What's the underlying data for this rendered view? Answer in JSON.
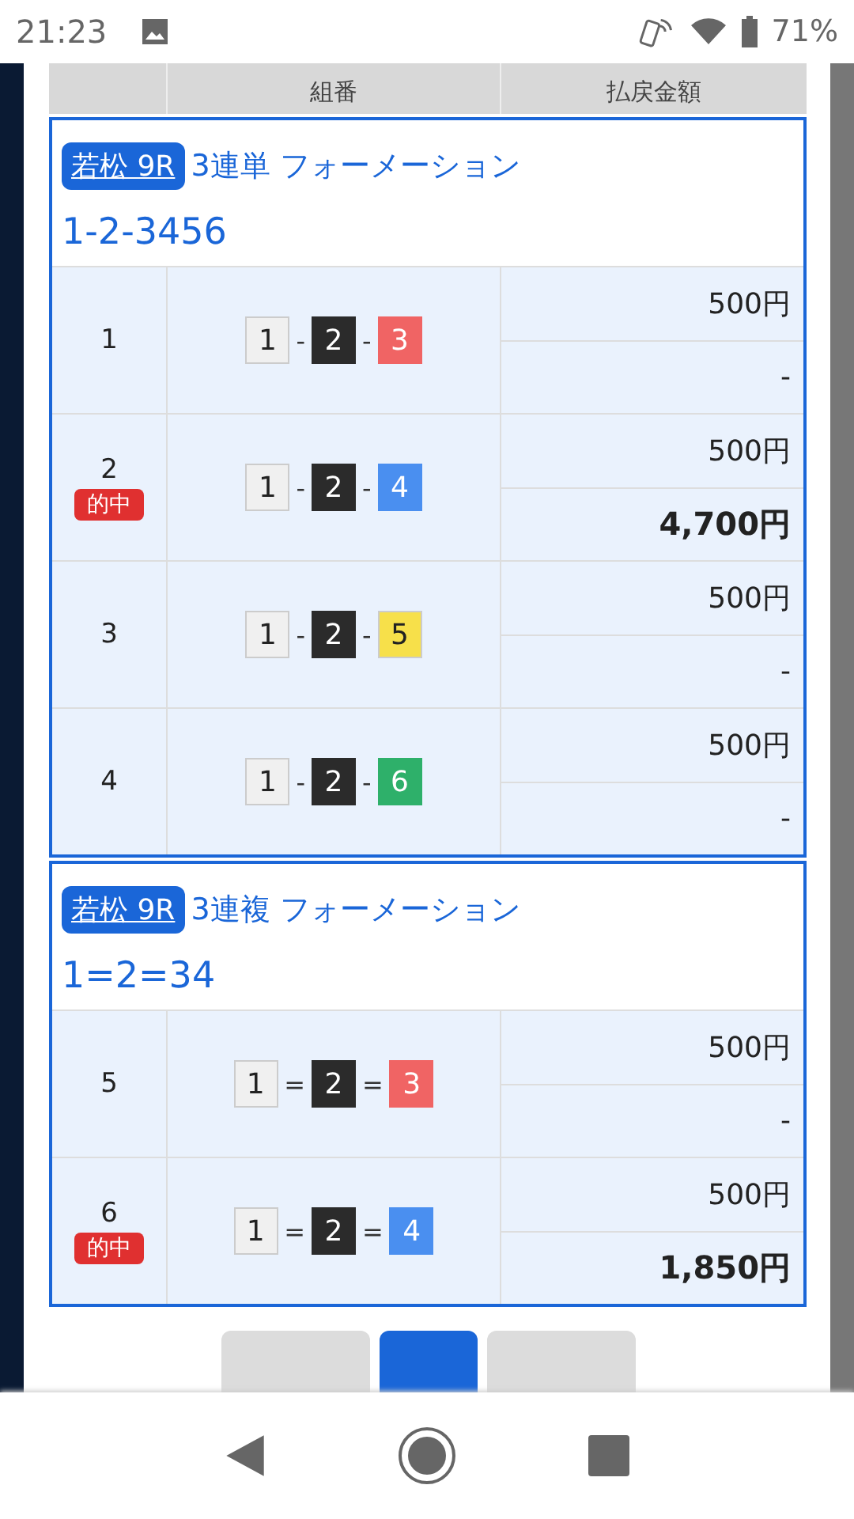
{
  "status_bar": {
    "time": "21:23",
    "battery": "71%"
  },
  "table": {
    "columns": [
      "組番",
      "払戻金額"
    ],
    "groups": [
      {
        "venue": "若松 9R",
        "bet_type": "3連単 フォーメーション",
        "formation": "1-2-3456",
        "rows": [
          {
            "no": "1",
            "hit": false,
            "separator": "-",
            "boats": [
              {
                "num": "1",
                "color": "#f0f0f0"
              },
              {
                "num": "2",
                "color": "#2b2b2b"
              },
              {
                "num": "3",
                "color": "#f06464"
              }
            ],
            "stake": "500円",
            "payout": "-"
          },
          {
            "no": "2",
            "hit": true,
            "badge": "的中",
            "separator": "-",
            "boats": [
              {
                "num": "1",
                "color": "#f0f0f0"
              },
              {
                "num": "2",
                "color": "#2b2b2b"
              },
              {
                "num": "4",
                "color": "#4a8ff0"
              }
            ],
            "stake": "500円",
            "payout": "4,700円"
          },
          {
            "no": "3",
            "hit": false,
            "separator": "-",
            "boats": [
              {
                "num": "1",
                "color": "#f0f0f0"
              },
              {
                "num": "2",
                "color": "#2b2b2b"
              },
              {
                "num": "5",
                "color": "#f7e04a"
              }
            ],
            "stake": "500円",
            "payout": "-"
          },
          {
            "no": "4",
            "hit": false,
            "separator": "-",
            "boats": [
              {
                "num": "1",
                "color": "#f0f0f0"
              },
              {
                "num": "2",
                "color": "#2b2b2b"
              },
              {
                "num": "6",
                "color": "#2eb06a"
              }
            ],
            "stake": "500円",
            "payout": "-"
          }
        ]
      },
      {
        "venue": "若松 9R",
        "bet_type": "3連複 フォーメーション",
        "formation": "1=2=34",
        "rows": [
          {
            "no": "5",
            "hit": false,
            "separator": "=",
            "boats": [
              {
                "num": "1",
                "color": "#f0f0f0"
              },
              {
                "num": "2",
                "color": "#2b2b2b"
              },
              {
                "num": "3",
                "color": "#f06464"
              }
            ],
            "stake": "500円",
            "payout": "-"
          },
          {
            "no": "6",
            "hit": true,
            "badge": "的中",
            "separator": "=",
            "boats": [
              {
                "num": "1",
                "color": "#f0f0f0"
              },
              {
                "num": "2",
                "color": "#2b2b2b"
              },
              {
                "num": "4",
                "color": "#4a8ff0"
              }
            ],
            "stake": "500円",
            "payout": "1,850円"
          }
        ]
      }
    ]
  },
  "pagination": [
    {
      "selected": false
    },
    {
      "selected": true
    },
    {
      "selected": false
    }
  ]
}
